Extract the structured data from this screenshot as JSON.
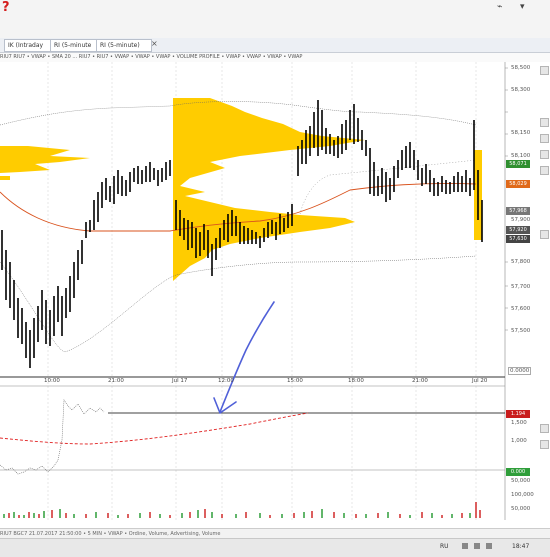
{
  "app_icon_text": "?",
  "window_controls": [
    "⌁",
    "▾"
  ],
  "tabs": [
    {
      "label": "IK (Intraday"
    },
    {
      "label": "RI (5-minute"
    },
    {
      "label": "RI (5-minute)"
    }
  ],
  "info_text": "RIU7  RIU7 • VWAP • SMA 20 ...  RIU7 • RIU7 • VWAP • VWAP • VWAP • VOLUME PROFILE • VWAP • VWAP • VWAP • VWAP",
  "price_axis": {
    "labels": [
      "58,500",
      "58,300",
      "58,150",
      "58,100",
      "57,900",
      "57,800",
      "57,700",
      "57,600",
      "57,500"
    ],
    "badges": [
      {
        "text": "58,071",
        "color": "#2f8f2f"
      },
      {
        "text": "58,029",
        "color": "#e06a1a"
      },
      {
        "text": "57,968",
        "color": "#777777"
      },
      {
        "text": "57,920",
        "color": "#555555"
      },
      {
        "text": "57,630",
        "color": "#444444"
      }
    ]
  },
  "time_axis": {
    "labels": [
      "10:00",
      "21:00",
      "Jul 17",
      "12:00",
      "15:00",
      "18:00",
      "21:00",
      "Jul 20"
    ]
  },
  "lower_axis": {
    "labels": [
      "1,500",
      "1,000",
      "50,000",
      "100,000",
      "50,000"
    ],
    "badges": [
      {
        "text": "1.194",
        "color": "#c91c1c"
      },
      {
        "text": "0.000",
        "color": "#2f9e3a"
      }
    ]
  },
  "zero_value": "0.0000",
  "status_text": "RIU7  BGC7  21.07.2017 21:50:00 • 5 MIN • VWAP • Ordine, Volume, Advertising, Volume",
  "taskbar": {
    "lang": "RU",
    "time": "18:47"
  },
  "colors": {
    "profile": "#FFCC00",
    "vwap": "#d9531e",
    "macd_signal": "#e02020",
    "annotation": "#5060d8"
  }
}
